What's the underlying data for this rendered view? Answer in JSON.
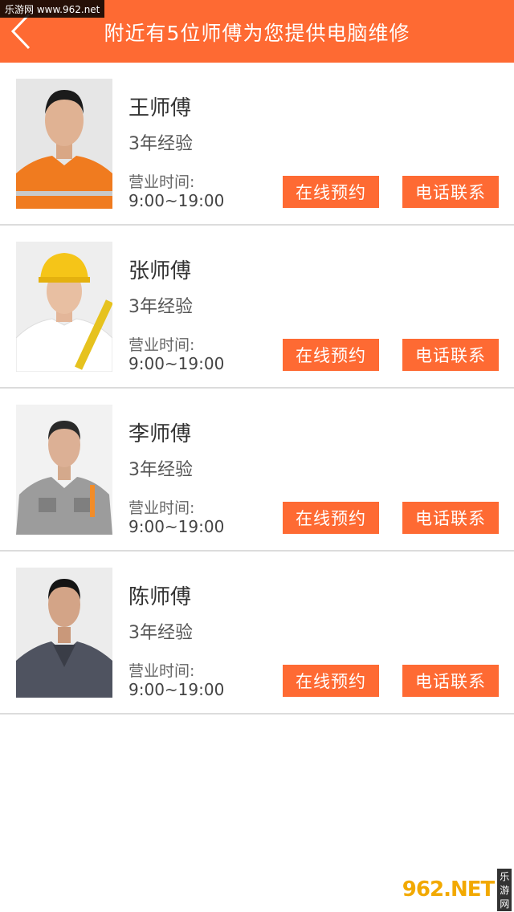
{
  "watermark": {
    "top_text": "乐游网 www.962.net",
    "bottom_brand": "962.NET",
    "bottom_sub": "乐游网"
  },
  "header": {
    "title": "附近有5位师傅为您提供电脑维修",
    "back_icon": "chevron-left-icon",
    "color": "#fe6a33"
  },
  "technicians": [
    {
      "name": "王师傅",
      "experience": "3年经验",
      "hours_label": "营业时间:",
      "hours": "9:00~19:00",
      "book_label": "在线预约",
      "call_label": "电话联系",
      "outfit": "orange"
    },
    {
      "name": "张师傅",
      "experience": "3年经验",
      "hours_label": "营业时间:",
      "hours": "9:00~19:00",
      "book_label": "在线预约",
      "call_label": "电话联系",
      "outfit": "hardhat"
    },
    {
      "name": "李师傅",
      "experience": "3年经验",
      "hours_label": "营业时间:",
      "hours": "9:00~19:00",
      "book_label": "在线预约",
      "call_label": "电话联系",
      "outfit": "grey"
    },
    {
      "name": "陈师傅",
      "experience": "3年经验",
      "hours_label": "营业时间:",
      "hours": "9:00~19:00",
      "book_label": "在线预约",
      "call_label": "电话联系",
      "outfit": "dark"
    }
  ]
}
